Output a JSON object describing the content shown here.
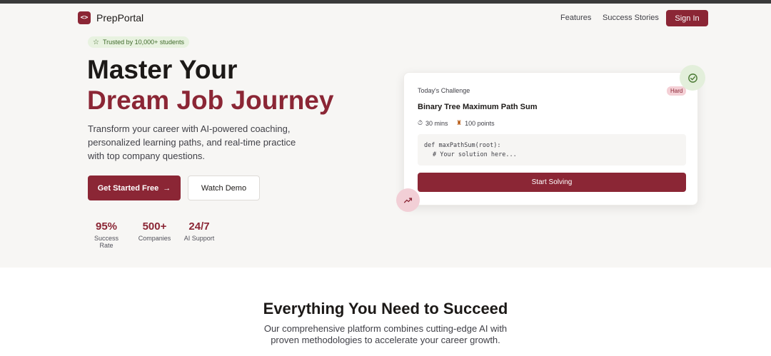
{
  "nav": {
    "logo_text": "PrepPortal",
    "logo_icon": "code-brackets-icon",
    "links": [
      "Features",
      "Success Stories"
    ],
    "signin_label": "Sign In"
  },
  "hero": {
    "trust_badge": "Trusted by 10,000+ students",
    "title_line1": "Master Your",
    "title_line2": "Dream Job Journey",
    "subtitle": "Transform your career with AI-powered coaching, personalized learning paths, and real-time practice with top company questions.",
    "primary_button": "Get Started Free",
    "secondary_button": "Watch Demo",
    "stats": [
      {
        "value": "95%",
        "label": "Success Rate"
      },
      {
        "value": "500+",
        "label": "Companies"
      },
      {
        "value": "24/7",
        "label": "AI Support"
      }
    ]
  },
  "challenge": {
    "label": "Today's Challenge",
    "difficulty": "Hard",
    "title": "Binary Tree Maximum Path Sum",
    "time": "30 mins",
    "points": "100 points",
    "code_line1": "def maxPathSum(root):",
    "code_line2": "# Your solution here...",
    "button": "Start Solving"
  },
  "features": {
    "title": "Everything You Need to Succeed",
    "subtitle": "Our comprehensive platform combines cutting-edge AI with proven methodologies to accelerate your career growth."
  },
  "colors": {
    "brand": "#8b2635",
    "hero_bg": "#f7f6f4",
    "trust_bg": "#e8f2e0"
  }
}
